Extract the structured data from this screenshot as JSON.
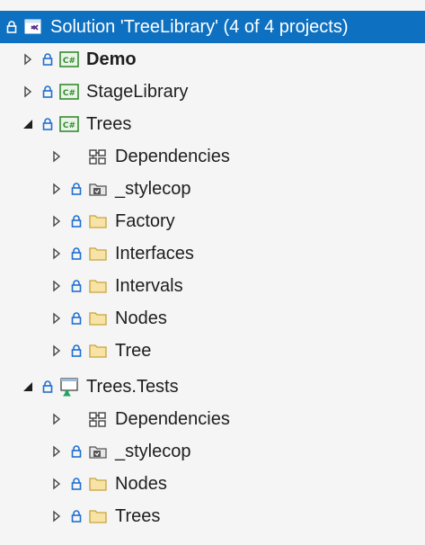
{
  "solution": {
    "label": "Solution 'TreeLibrary' (4 of 4 projects)"
  },
  "projects": [
    {
      "label": "Demo"
    },
    {
      "label": "StageLibrary"
    },
    {
      "label": "Trees",
      "children": [
        {
          "label": "Dependencies"
        },
        {
          "label": "_stylecop"
        },
        {
          "label": "Factory"
        },
        {
          "label": "Interfaces"
        },
        {
          "label": "Intervals"
        },
        {
          "label": "Nodes"
        },
        {
          "label": "Tree"
        }
      ]
    },
    {
      "label": "Trees.Tests",
      "children": [
        {
          "label": "Dependencies"
        },
        {
          "label": "_stylecop"
        },
        {
          "label": "Nodes"
        },
        {
          "label": "Trees"
        }
      ]
    }
  ],
  "colors": {
    "selection": "#0e70c0",
    "lock": "#1f6fd1",
    "folder_fill": "#f7e3a5",
    "folder_stroke": "#c8a43c",
    "csharp_green": "#388a34",
    "test_green": "#21a366"
  },
  "icons": {
    "expanded": "collapse-arrow-icon",
    "collapsed": "expand-arrow-icon",
    "lock": "lock-icon",
    "solution": "solution-icon",
    "csharp_project": "csharp-project-icon",
    "test_project": "test-project-icon",
    "dependencies": "dependencies-icon",
    "config_folder": "stylecop-folder-icon",
    "folder": "folder-icon"
  }
}
